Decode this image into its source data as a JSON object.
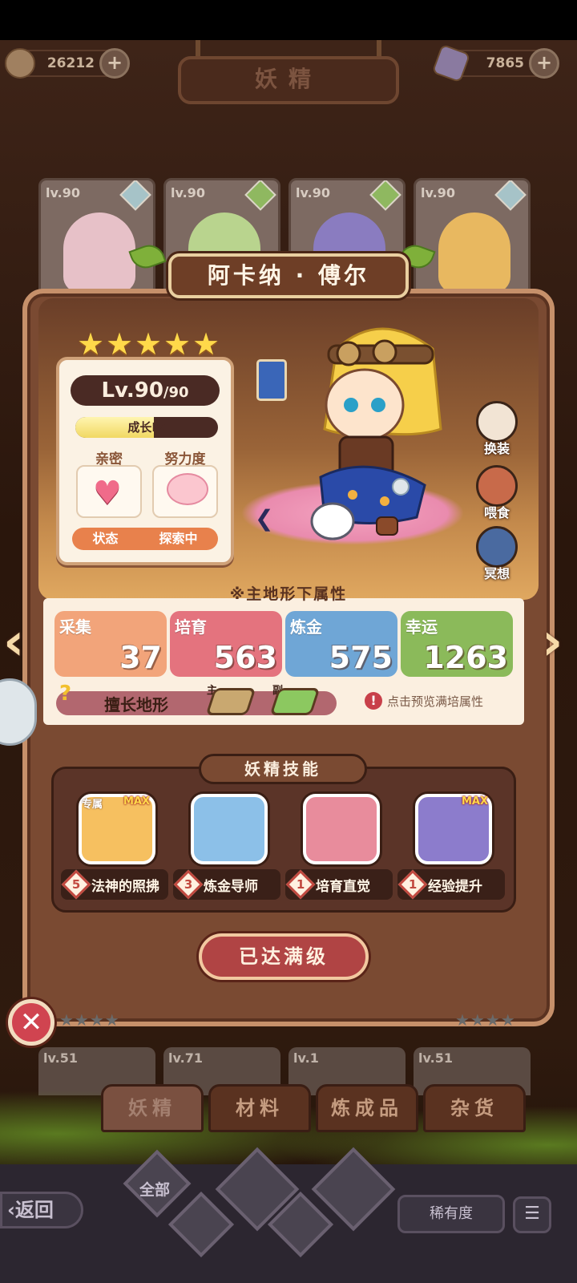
{
  "header": {
    "gold": "26212",
    "gems": "7865",
    "title": "妖精"
  },
  "top_cards": [
    {
      "level": "lv.90"
    },
    {
      "level": "lv.90"
    },
    {
      "level": "lv.90"
    },
    {
      "level": "lv.90"
    }
  ],
  "fairy": {
    "name": "阿卡纳 · 傅尔",
    "stars": 5,
    "level_main": "Lv.90",
    "level_max": "/90",
    "growth": "成长IV",
    "growth_fill": 0.55,
    "intimacy_label": "亲密",
    "effort_label": "努力度",
    "status_label": "状态",
    "status_value": "探索中"
  },
  "side_buttons": {
    "outfit": "换装",
    "feed": "喂食",
    "meditate": "冥想"
  },
  "attributes": {
    "header": "※主地形下属性",
    "items": [
      {
        "label": "采集",
        "value": "37",
        "color": "#f2a47a"
      },
      {
        "label": "培育",
        "value": "563",
        "color": "#e4737e"
      },
      {
        "label": "炼金",
        "value": "575",
        "color": "#6fa6d6"
      },
      {
        "label": "幸运",
        "value": "1263",
        "color": "#8bba5a"
      }
    ],
    "terrain_label": "擅长地形",
    "terrain_main": "主",
    "terrain_sub": "副",
    "preview_hint": "点击预览满培属性"
  },
  "skills": {
    "header": "妖精技能",
    "exclusive_tag": "专属",
    "max_tag": "MAX",
    "items": [
      {
        "level": "5",
        "name": "法神的照拂"
      },
      {
        "level": "3",
        "name": "炼金导师"
      },
      {
        "level": "1",
        "name": "培育直觉"
      },
      {
        "level": "1",
        "name": "经验提升"
      }
    ]
  },
  "max_button": "已达满级",
  "bottom_cards": [
    {
      "level": "lv.51"
    },
    {
      "level": "lv.71"
    },
    {
      "level": "lv.1"
    },
    {
      "level": "lv.51"
    }
  ],
  "tabs": [
    "妖精",
    "材料",
    "炼成品",
    "杂货"
  ],
  "footer": {
    "back": "返回",
    "all": "全部",
    "rarity": "稀有度"
  }
}
